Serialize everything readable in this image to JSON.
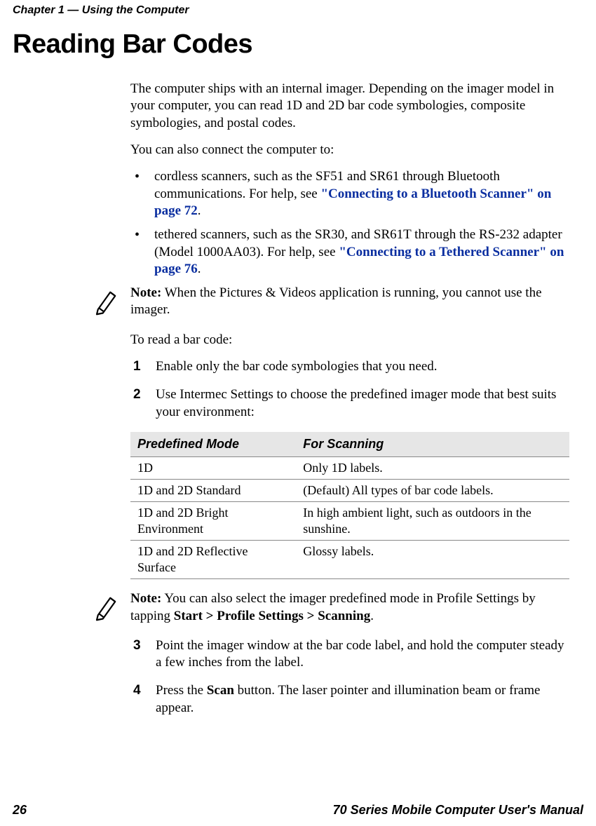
{
  "running_header": "Chapter 1 — Using the Computer",
  "title": "Reading Bar Codes",
  "intro_p1": "The computer ships with an internal imager. Depending on the imager model in your computer, you can read 1D and 2D bar code symbologies, composite symbologies, and postal codes.",
  "intro_p2": "You can also connect the computer to:",
  "bullets": [
    {
      "pre": "cordless scanners, such as the SF51 and SR61 through Bluetooth communications. For help, see ",
      "link": "\"Connecting to a Bluetooth Scanner\" on page 72",
      "post": "."
    },
    {
      "pre": "tethered scanners, such as the SR30, and SR61T through the RS-232 adapter (Model 1000AA03). For help, see ",
      "link": "\"Connecting to a Tethered Scanner\" on page 76",
      "post": "."
    }
  ],
  "note1": {
    "label": "Note:",
    "text": "  When the Pictures & Videos application is running, you cannot use the imager."
  },
  "procedure_intro": "To read a bar code:",
  "steps12": [
    "Enable only the bar code symbologies that you need.",
    "Use Intermec Settings to choose the predefined imager mode that best suits your environment:"
  ],
  "table": {
    "headers": [
      "Predefined Mode",
      "For Scanning"
    ],
    "rows": [
      [
        "1D",
        "Only 1D labels."
      ],
      [
        "1D and 2D Standard",
        "(Default) All types of bar code labels."
      ],
      [
        "1D and 2D Bright Environment",
        "In high ambient light, such as outdoors in the sunshine."
      ],
      [
        "1D and 2D Reflective Surface",
        "Glossy labels."
      ]
    ]
  },
  "note2": {
    "label": "Note:",
    "pre": " You can also select the imager predefined mode in Profile Settings by tapping ",
    "strong": "Start > Profile Settings > Scanning",
    "post": "."
  },
  "steps34": [
    "Point the imager window at the bar code label, and hold the computer steady a few inches from the label.",
    {
      "pre": "Press the ",
      "strong": "Scan",
      "post": " button. The laser pointer and illumination beam or frame appear."
    }
  ],
  "footer_left": "26",
  "footer_right": "70 Series Mobile Computer User's Manual"
}
